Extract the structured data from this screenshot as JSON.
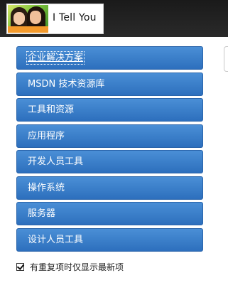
{
  "header": {
    "logo_text": "I Tell You"
  },
  "menu": {
    "items": [
      {
        "label": "企业解决方案"
      },
      {
        "label": "MSDN 技术资源库"
      },
      {
        "label": "工具和资源"
      },
      {
        "label": "应用程序"
      },
      {
        "label": "开发人员工具"
      },
      {
        "label": "操作系统"
      },
      {
        "label": "服务器"
      },
      {
        "label": "设计人员工具"
      }
    ]
  },
  "footer": {
    "checkbox_checked": true,
    "checkbox_label": "有重复项时仅显示最新项"
  },
  "colors": {
    "menu_bg": "#3a7fcd",
    "topbar_bg": "#222222"
  }
}
